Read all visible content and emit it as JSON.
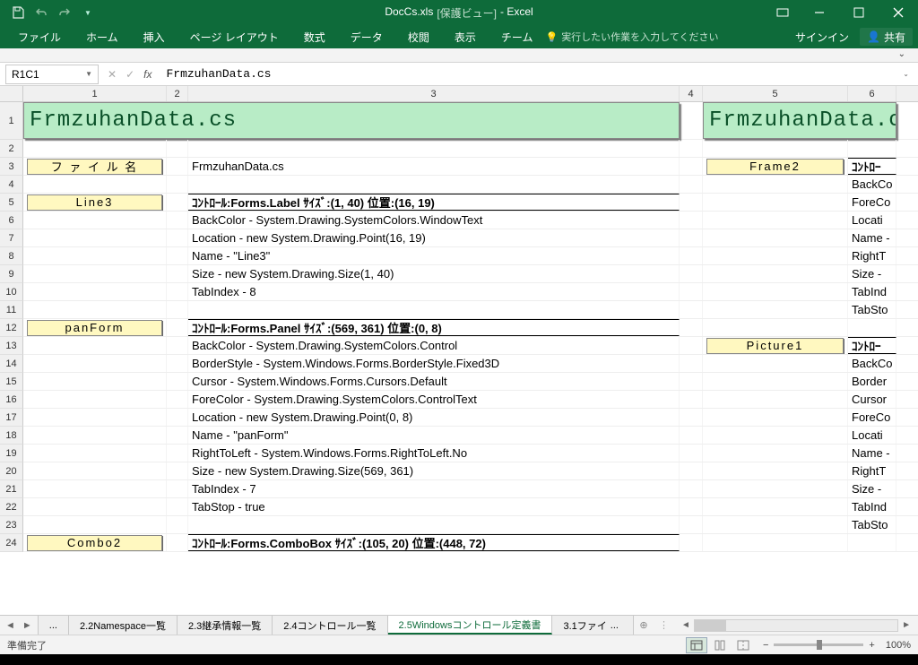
{
  "title": {
    "filename": "DocCs.xls",
    "mode": "[保護ビュー]",
    "app": "- Excel"
  },
  "ribbon": {
    "file": "ファイル",
    "home": "ホーム",
    "insert": "挿入",
    "pagelayout": "ページ レイアウト",
    "formulas": "数式",
    "data": "データ",
    "review": "校閲",
    "view": "表示",
    "team": "チーム",
    "tellme": "実行したい作業を入力してください",
    "signin": "サインイン",
    "share": "共有"
  },
  "namebox": "R1C1",
  "formula": "FrmzuhanData.cs",
  "columns": {
    "c1": "1",
    "c2": "2",
    "c3": "3",
    "c4": "4",
    "c5": "5",
    "c6": "6"
  },
  "rownums": [
    "1",
    "2",
    "3",
    "4",
    "5",
    "6",
    "7",
    "8",
    "9",
    "10",
    "11",
    "12",
    "13",
    "14",
    "15",
    "16",
    "17",
    "18",
    "19",
    "20",
    "21",
    "22",
    "23",
    "24"
  ],
  "titleCells": {
    "left": "FrmzuhanData.cs",
    "right": "FrmzuhanData.c"
  },
  "labels": {
    "filename": "フ ァ イ ル 名",
    "line3": "Line3",
    "panform": "panForm",
    "combo2": "Combo2",
    "frame2": "Frame2",
    "picture1": "Picture1"
  },
  "cells": {
    "r3c3": "FrmzuhanData.cs",
    "r5c3": "ｺﾝﾄﾛｰﾙ:Forms.Label ｻｲｽﾞ:(1, 40) 位置:(16, 19)",
    "r6c3": "BackColor - System.Drawing.SystemColors.WindowText",
    "r7c3": "Location - new System.Drawing.Point(16, 19)",
    "r8c3": "Name - \"Line3\"",
    "r9c3": "Size - new System.Drawing.Size(1, 40)",
    "r10c3": "TabIndex - 8",
    "r12c3": "ｺﾝﾄﾛｰﾙ:Forms.Panel ｻｲｽﾞ:(569, 361) 位置:(0, 8)",
    "r13c3": "BackColor - System.Drawing.SystemColors.Control",
    "r14c3": "BorderStyle - System.Windows.Forms.BorderStyle.Fixed3D",
    "r15c3": "Cursor - System.Windows.Forms.Cursors.Default",
    "r16c3": "ForeColor - System.Drawing.SystemColors.ControlText",
    "r17c3": "Location - new System.Drawing.Point(0, 8)",
    "r18c3": "Name - \"panForm\"",
    "r19c3": "RightToLeft - System.Windows.Forms.RightToLeft.No",
    "r20c3": "Size - new System.Drawing.Size(569, 361)",
    "r21c3": "TabIndex - 7",
    "r22c3": "TabStop - true",
    "r24c3": "ｺﾝﾄﾛｰﾙ:Forms.ComboBox ｻｲｽﾞ:(105, 20) 位置:(448, 72)",
    "r3c6": "ｺﾝﾄﾛｰ",
    "r4c6": "BackCo",
    "r5c6": "ForeCo",
    "r6c6": "Locati",
    "r7c6": "Name -",
    "r8c6": "RightT",
    "r9c6": "Size -",
    "r10c6": "TabInd",
    "r11c6": "TabSto",
    "r13c6": "ｺﾝﾄﾛｰ",
    "r14c6": "BackCo",
    "r15c6": "Border",
    "r16c6": "Cursor",
    "r17c6": "ForeCo",
    "r18c6": "Locati",
    "r19c6": "Name -",
    "r20c6": "RightT",
    "r21c6": "Size -",
    "r22c6": "TabInd",
    "r23c6": "TabSto"
  },
  "sheetTabs": {
    "ellipsis": "...",
    "t1": "2.2Namespace一覧",
    "t2": "2.3継承情報一覧",
    "t3": "2.4コントロール一覧",
    "t4": "2.5Windowsコントロール定義書",
    "t5": "3.1ファイ",
    "t5dots": "..."
  },
  "status": {
    "ready": "準備完了",
    "zoom": "100%"
  }
}
